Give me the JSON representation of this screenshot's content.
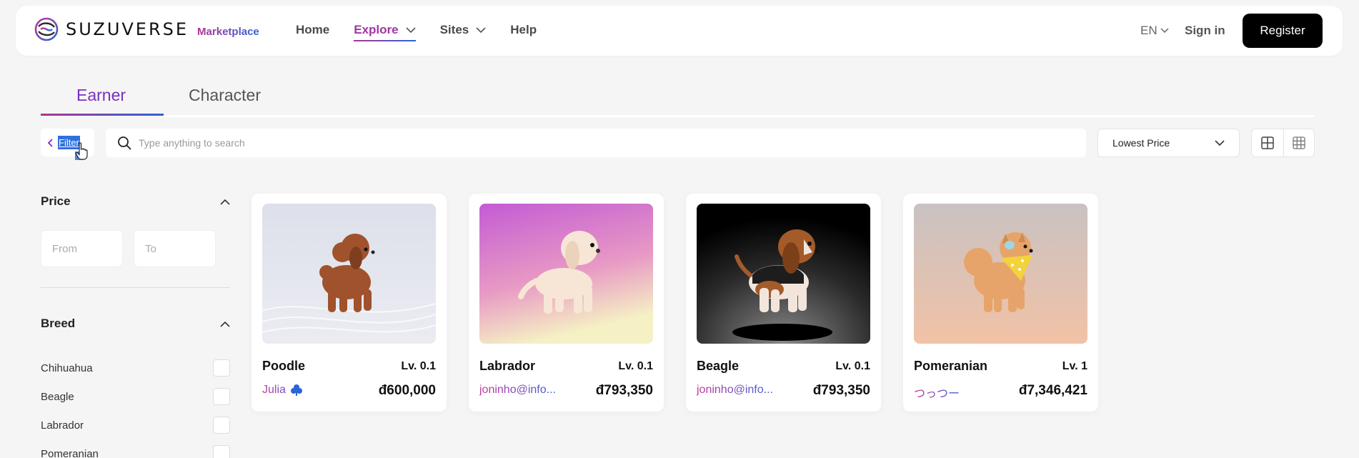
{
  "header": {
    "brand": "SUZUVERSE",
    "brand_sub": "Marketplace",
    "nav": [
      {
        "label": "Home",
        "dropdown": false,
        "active": false
      },
      {
        "label": "Explore",
        "dropdown": true,
        "active": true
      },
      {
        "label": "Sites",
        "dropdown": true,
        "active": false
      },
      {
        "label": "Help",
        "dropdown": false,
        "active": false
      }
    ],
    "language": "EN",
    "sign_in": "Sign in",
    "register": "Register"
  },
  "tabs": [
    {
      "label": "Earner",
      "active": true
    },
    {
      "label": "Character",
      "active": false
    }
  ],
  "toolbar": {
    "filter_label": "Filter",
    "search_placeholder": "Type anything to search",
    "sort_value": "Lowest Price",
    "view_modes": [
      "large-grid-icon",
      "small-grid-icon"
    ]
  },
  "sidebar": {
    "price": {
      "title": "Price",
      "from_placeholder": "From",
      "to_placeholder": "To"
    },
    "breed": {
      "title": "Breed",
      "items": [
        "Chihuahua",
        "Beagle",
        "Labrador",
        "Pomeranian"
      ]
    }
  },
  "cards": [
    {
      "name": "Poodle",
      "level": "Lv. 0.1",
      "owner": "Julia",
      "owner_badge": "club-icon",
      "price": "đ600,000",
      "bg": [
        "#dde0ea",
        "#e9ebf1"
      ]
    },
    {
      "name": "Labrador",
      "level": "Lv. 0.1",
      "owner": "joninho@info...",
      "price": "đ793,350",
      "bg": [
        "#c35bd4",
        "#f3f0c6"
      ]
    },
    {
      "name": "Beagle",
      "level": "Lv. 0.1",
      "owner": "joninho@info...",
      "price": "đ793,350",
      "bg": [
        "#000000",
        "#777777"
      ]
    },
    {
      "name": "Pomeranian",
      "level": "Lv. 1",
      "owner": "つっつー",
      "price": "đ7,346,421",
      "bg": [
        "#c9c2c2",
        "#f0c3a8"
      ]
    }
  ],
  "colors": {
    "accent_pink": "#b0338f",
    "accent_blue": "#2b64d8",
    "selection": "#2f6fe0"
  }
}
